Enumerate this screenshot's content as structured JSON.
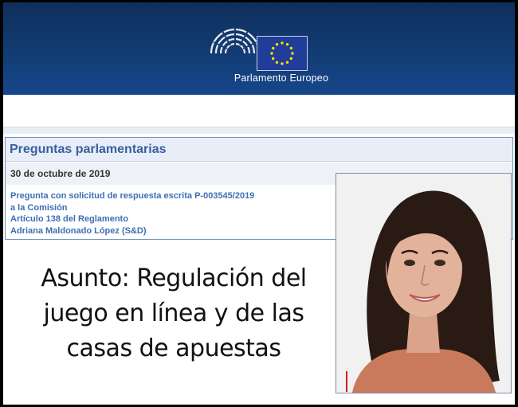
{
  "header": {
    "brand_name": "Parlamento Europeo",
    "colors": {
      "banner": "#123c74",
      "flag_blue": "#1f3d99",
      "flag_stars": "#ffdd00"
    }
  },
  "question": {
    "section_title": "Preguntas parlamentarias",
    "date": "30 de octubre de 2019",
    "lines": [
      "Pregunta con solicitud de respuesta escrita  P-003545/2019",
      "a la Comisión",
      "Artículo 138 del Reglamento",
      "Adriana Maldonado López (S&D)"
    ]
  },
  "subject": {
    "line1": "Asunto: Regulación del",
    "line2": "juego en línea y de las",
    "line3": "casas de apuestas"
  },
  "photo": {
    "description_icon": "portrait-photo"
  }
}
